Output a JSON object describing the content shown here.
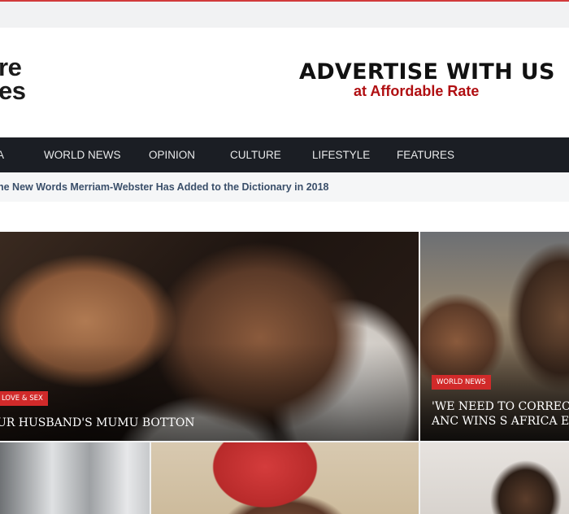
{
  "logo": {
    "line1": "re",
    "line2": "es"
  },
  "ad": {
    "headline": "ADVERTISE WITH US",
    "subline": "at Affordable Rate"
  },
  "nav": {
    "items": [
      "A",
      "WORLD NEWS",
      "OPINION",
      "CULTURE",
      "LIFESTYLE",
      "FEATURES"
    ]
  },
  "ticker": {
    "text": "he New Words Merriam-Webster Has Added to the Dictionary in 2018"
  },
  "featured": [
    {
      "category": "LOVE & SEX",
      "title": "UR HUSBAND'S MUMU BOTTON"
    },
    {
      "category": "WORLD NEWS",
      "title_line1": "'WE NEED TO CORRECT C",
      "title_line2": "ANC WINS S AFRICA ELE"
    }
  ],
  "colors": {
    "accent": "#d12a2a",
    "nav_bg": "#1b1e24",
    "ad_red": "#b00f12"
  }
}
